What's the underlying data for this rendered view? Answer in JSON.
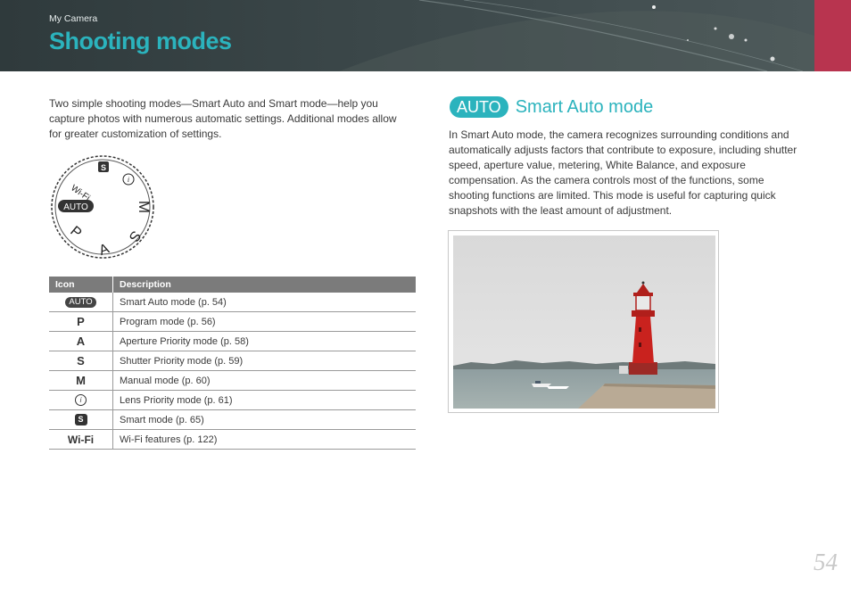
{
  "header": {
    "breadcrumb": "My Camera",
    "title": "Shooting modes"
  },
  "intro": "Two simple shooting modes—Smart Auto and Smart mode—help you capture photos with numerous automatic settings. Additional modes allow for greater customization of settings.",
  "dial": {
    "labels": [
      "Wi-Fi",
      "S",
      "i",
      "AUTO",
      "M",
      "S",
      "A",
      "P"
    ]
  },
  "table": {
    "headers": [
      "Icon",
      "Description"
    ],
    "rows": [
      {
        "icon": "AUTO",
        "icon_type": "auto-pill",
        "description": "Smart Auto mode (p. 54)"
      },
      {
        "icon": "P",
        "icon_type": "letter",
        "description": "Program mode (p. 56)"
      },
      {
        "icon": "A",
        "icon_type": "letter",
        "description": "Aperture Priority mode (p. 58)"
      },
      {
        "icon": "S",
        "icon_type": "letter",
        "description": "Shutter Priority mode (p. 59)"
      },
      {
        "icon": "M",
        "icon_type": "letter",
        "description": "Manual mode (p. 60)"
      },
      {
        "icon": "i",
        "icon_type": "i-circle",
        "description": "Lens Priority mode (p. 61)"
      },
      {
        "icon": "S",
        "icon_type": "s-badge",
        "description": "Smart mode (p. 65)"
      },
      {
        "icon": "Wi-Fi",
        "icon_type": "wifi",
        "description": "Wi-Fi features (p. 122)"
      }
    ]
  },
  "section": {
    "badge": "AUTO",
    "title": "Smart Auto mode",
    "body": "In Smart Auto mode, the camera recognizes surrounding conditions and automatically adjusts factors that contribute to exposure, including shutter speed, aperture value, metering, White Balance, and exposure compensation. As the camera controls most of the functions, some shooting functions are limited. This mode is useful for capturing quick snapshots with the least amount of adjustment."
  },
  "page_number": "54",
  "colors": {
    "accent": "#2bb3bd",
    "tab": "#b8344f",
    "header_bg": "#3b4749"
  }
}
